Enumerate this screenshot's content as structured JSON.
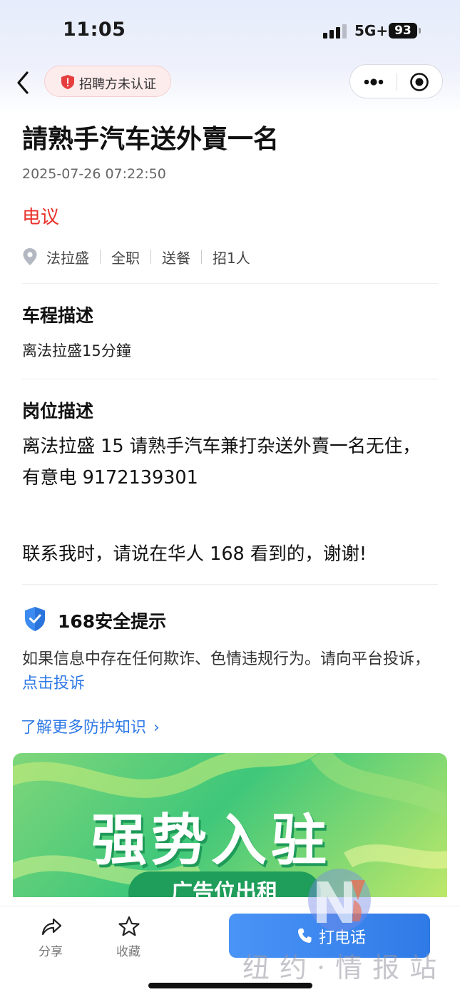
{
  "status_bar": {
    "time": "11:05",
    "network": "5G+",
    "battery": "93"
  },
  "nav": {
    "cert_label": "招聘方未认证"
  },
  "job": {
    "title": "請熟手汽车送外賣一名",
    "date": "2025-07-26 07:22:50",
    "salary": "电议",
    "tags": [
      "法拉盛",
      "全职",
      "送餐",
      "招1人"
    ]
  },
  "commute": {
    "heading": "车程描述",
    "text": "离法拉盛15分鐘"
  },
  "description": {
    "heading": "岗位描述",
    "text": "离法拉盛 15 请熟手汽车兼打杂送外賣一名无住，有意电 9172139301",
    "footer": "联系我时，请说在华人 168 看到的，谢谢!"
  },
  "safety": {
    "title": "168安全提示",
    "text": "如果信息中存在任何欺诈、色情违规行为。请向平台投诉，",
    "link": "点击投诉",
    "more": "了解更多防护知识"
  },
  "banner": {
    "title": "强势入驻",
    "subtitle": "广告位出租"
  },
  "bottom": {
    "share": "分享",
    "favorite": "收藏",
    "call": "打电话"
  },
  "watermark": {
    "text": "纽约·情报站"
  },
  "colors": {
    "accent": "#2f7ae6",
    "salary": "#e8332c",
    "banner": "#3fc77a"
  }
}
